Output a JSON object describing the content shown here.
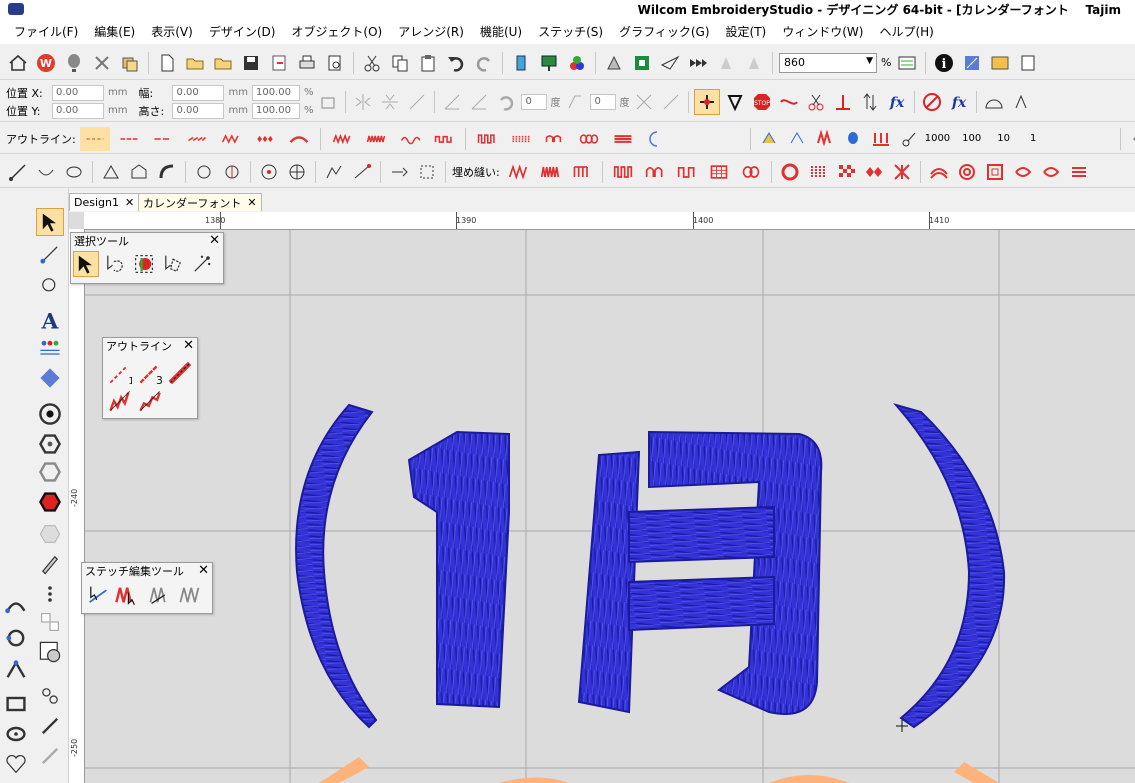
{
  "titlebar": {
    "title": "Wilcom EmbroideryStudio - デザイニング 64-bit - [カレンダーフォント",
    "title_right": "Tajim"
  },
  "menu": [
    "ファイル(F)",
    "編集(E)",
    "表示(V)",
    "デザイン(D)",
    "オブジェクト(O)",
    "アレンジ(R)",
    "機能(U)",
    "ステッチ(S)",
    "グラフィック(G)",
    "設定(T)",
    "ウィンドウ(W)",
    "ヘルプ(H)"
  ],
  "toolbar": {
    "zoom_value": "860",
    "zoom_unit": "%"
  },
  "properties": {
    "pos_x_label": "位置 X:",
    "pos_y_label": "位置 Y:",
    "pos_x_value": "0.00",
    "pos_y_value": "0.00",
    "width_label": "幅:",
    "height_label": "高さ:",
    "width_value": "0.00",
    "height_value": "0.00",
    "unit_mm": "mm",
    "scale_w": "100.00",
    "scale_h": "100.00",
    "percent": "%",
    "rotate_value": "0",
    "slant_value": "0",
    "degree_label": "度"
  },
  "outline_toolbar": {
    "label": "アウトライン:",
    "fill_label": "埋め縫い:"
  },
  "stitch_numbers": [
    "1000",
    "100",
    "10",
    "1"
  ],
  "tabs": [
    {
      "label": "Design1",
      "close": "✕"
    },
    {
      "label": "カレンダーフォント",
      "close": "✕",
      "active": true
    }
  ],
  "rulers": {
    "top": [
      "1380",
      "1390",
      "1400",
      "1410"
    ],
    "left": [
      "-240",
      "-250"
    ]
  },
  "panels": {
    "selection_tools": {
      "title": "選択ツール",
      "close": "✕"
    },
    "outline_panel": {
      "title": "アウトライン",
      "close": "✕",
      "btn_labels": [
        "1",
        "3"
      ]
    },
    "stitch_edit": {
      "title": "ステッチ編集ツール",
      "close": "✕"
    }
  },
  "colors": {
    "embroidery_blue": "#2f2fd6",
    "embroidery_dark": "#1a1a9a",
    "orange": "#ffb27a",
    "canvas": "#dcdcdc",
    "grid": "#a9a9a9",
    "red_stitch": "#e03030"
  }
}
